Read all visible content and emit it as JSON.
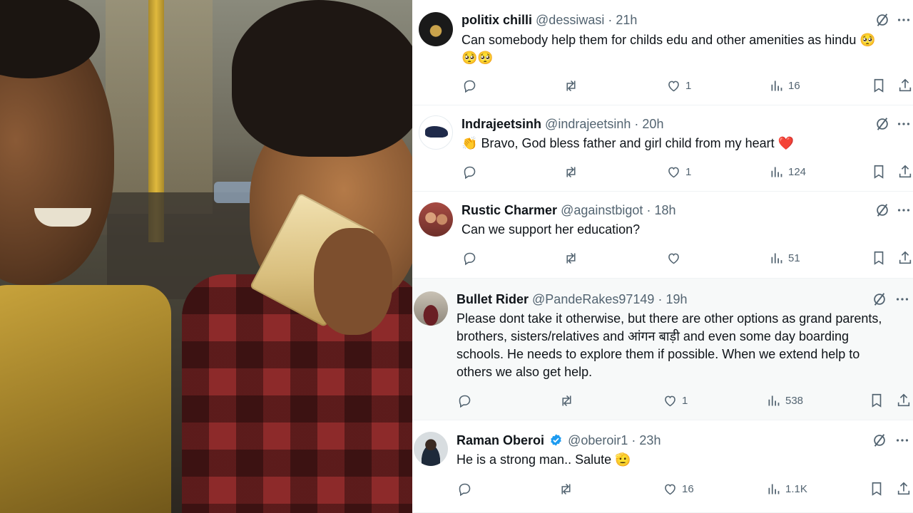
{
  "replies": [
    {
      "name": "politix chilli",
      "handle": "@dessiwasi",
      "sep": "·",
      "time": "21h",
      "text": "Can somebody help them for childs edu and other amenities as hindu 🥺",
      "text_2": "🥺🥺",
      "replies": "",
      "reposts": "",
      "likes": "1",
      "views": "16",
      "verified": false
    },
    {
      "name": "Indrajeetsinh",
      "handle": "@indrajeetsinh",
      "sep": "·",
      "time": "20h",
      "emoji_prefix": "👏",
      "text": "Bravo, God bless father and girl child from my heart",
      "emoji_suffix": "❤️",
      "replies": "",
      "reposts": "",
      "likes": "1",
      "views": "124",
      "verified": false
    },
    {
      "name": "Rustic Charmer",
      "handle": "@againstbigot",
      "sep": "·",
      "time": "18h",
      "text": "Can we support her education?",
      "replies": "",
      "reposts": "",
      "likes": "",
      "views": "51",
      "verified": false
    },
    {
      "name": "Bullet Rider",
      "handle": "@PandeRakes97149",
      "sep": "·",
      "time": "19h",
      "lines": [
        "Please dont take it otherwise,  but there are other options as grand parents,",
        "brothers, sisters/relatives and आंगन बाड़ी  and even  some day boarding",
        "schools. He needs to explore them if possible. When we extend help to",
        "others we also get help."
      ],
      "replies": "",
      "reposts": "",
      "likes": "1",
      "views": "538",
      "verified": false
    },
    {
      "name": "Raman Oberoi",
      "handle": "@oberoir1",
      "sep": "·",
      "time": "23h",
      "text": "He is a strong man.. Salute",
      "emoji_suffix": "🫡",
      "replies": "",
      "reposts": "",
      "likes": "16",
      "views": "1.1K",
      "verified": true
    }
  ],
  "colors": {
    "text": "#0f1419",
    "secondary": "#536471",
    "verified": "#1d9bf0",
    "divider": "#eff3f4",
    "highlight": "#f7f9f9"
  },
  "icons": {
    "reply": "speech-bubble-icon",
    "repost": "repost-arrows-icon",
    "like": "heart-icon",
    "views": "bar-chart-icon",
    "bookmark": "bookmark-icon",
    "share": "share-upload-icon",
    "grok": "grok-slash-icon",
    "more": "more-dots-icon"
  }
}
